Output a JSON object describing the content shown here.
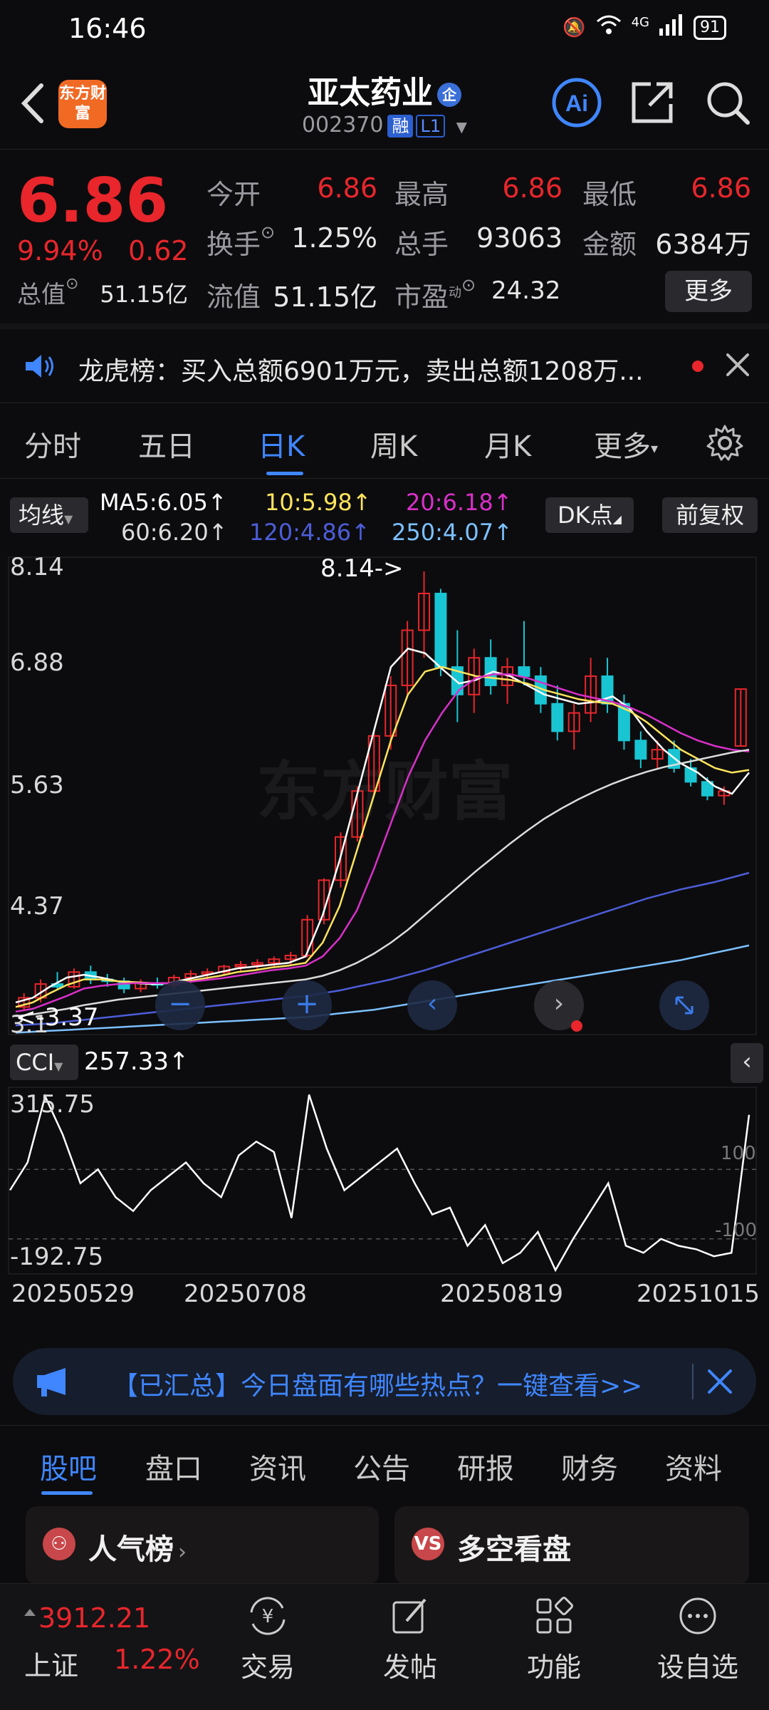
{
  "status_bar": {
    "time": "16:46",
    "network": "4G",
    "battery": "91"
  },
  "header": {
    "title": "亚太药业",
    "title_badge": "企",
    "code": "002370",
    "tag_margin": "融",
    "tag_level": "L1",
    "logo_text": "东方财富"
  },
  "quote": {
    "price": "6.86",
    "change_pct": "9.94%",
    "change": "0.62",
    "open_label": "今开",
    "open": "6.86",
    "high_label": "最高",
    "high": "6.86",
    "low_label": "最低",
    "low": "6.86",
    "turnover_label": "换手",
    "turnover": "1.25%",
    "volume_label": "总手",
    "volume": "93063",
    "amount_label": "金额",
    "amount": "6384万",
    "mktcap_label": "总值",
    "mktcap": "51.15亿",
    "float_label": "流值",
    "float": "51.15亿",
    "pe_label": "市盈",
    "pe_sup": "动",
    "pe": "24.32",
    "more_label": "更多"
  },
  "notice": {
    "text": "龙虎榜：买入总额6901万元，卖出总额1208万..."
  },
  "kline_tabs": [
    {
      "label": "分时"
    },
    {
      "label": "五日"
    },
    {
      "label": "日K"
    },
    {
      "label": "周K"
    },
    {
      "label": "月K"
    },
    {
      "label": "更多"
    }
  ],
  "active_kline_tab": "日K",
  "chart_controls": {
    "ma_button": "均线",
    "dk_button": "DK点",
    "fq_button": "前复权",
    "cci_button": "CCI"
  },
  "ma_legend": {
    "ma5": "MA5:6.05↑",
    "ma10": "10:5.98↑",
    "ma20": "20:6.18↑",
    "ma60": "60:6.20↑",
    "ma120": "120:4.86↑",
    "ma250": "250:4.07↑"
  },
  "colors": {
    "up": "#e8262c",
    "down": "#19c5d3",
    "ma5": "#ffffff",
    "ma10": "#ffe45c",
    "ma20": "#d830c8",
    "ma60": "#dcdcdc",
    "ma120": "#4d5dd8",
    "ma250": "#7cc0ff",
    "accent": "#3f86ff"
  },
  "chart_data": {
    "type": "line",
    "y_axis_labels": [
      "8.14",
      "6.88",
      "5.63",
      "4.37",
      "3.1"
    ],
    "ylim": [
      3.1,
      8.14
    ],
    "max_marker": "8.14->",
    "min_marker": "<-3.37",
    "x_ticks": [
      "20250529",
      "20250708",
      "20250819",
      "20251015"
    ],
    "series": [
      {
        "name": "MA5",
        "values": [
          3.45,
          3.5,
          3.62,
          3.72,
          3.75,
          3.72,
          3.68,
          3.66,
          3.65,
          3.66,
          3.7,
          3.74,
          3.78,
          3.82,
          3.84,
          3.86,
          3.88,
          3.95,
          4.4,
          5.0,
          5.7,
          6.4,
          7.1,
          7.3,
          7.25,
          7.08,
          6.92,
          6.96,
          7.05,
          7.0,
          6.9,
          6.8,
          6.75,
          6.7,
          6.72,
          6.78,
          6.65,
          6.4,
          6.2,
          6.05,
          5.95,
          5.8,
          5.72,
          5.95
        ]
      },
      {
        "name": "MA10",
        "values": [
          3.4,
          3.45,
          3.55,
          3.64,
          3.7,
          3.7,
          3.68,
          3.67,
          3.66,
          3.66,
          3.68,
          3.71,
          3.74,
          3.78,
          3.8,
          3.83,
          3.85,
          3.88,
          4.1,
          4.5,
          5.1,
          5.7,
          6.3,
          6.8,
          7.05,
          7.1,
          7.05,
          7.0,
          6.98,
          6.96,
          6.92,
          6.85,
          6.8,
          6.75,
          6.72,
          6.7,
          6.62,
          6.5,
          6.35,
          6.2,
          6.1,
          6.0,
          5.95,
          5.98
        ]
      },
      {
        "name": "MA20",
        "values": [
          3.35,
          3.38,
          3.45,
          3.52,
          3.6,
          3.63,
          3.65,
          3.66,
          3.66,
          3.66,
          3.67,
          3.69,
          3.71,
          3.74,
          3.77,
          3.8,
          3.82,
          3.85,
          3.95,
          4.15,
          4.45,
          4.9,
          5.4,
          5.9,
          6.3,
          6.6,
          6.85,
          6.98,
          7.02,
          7.02,
          6.98,
          6.92,
          6.86,
          6.8,
          6.76,
          6.72,
          6.66,
          6.58,
          6.48,
          6.38,
          6.3,
          6.24,
          6.2,
          6.18
        ]
      },
      {
        "name": "MA60",
        "values": [
          3.3,
          3.32,
          3.35,
          3.38,
          3.42,
          3.45,
          3.48,
          3.5,
          3.52,
          3.54,
          3.56,
          3.58,
          3.6,
          3.62,
          3.64,
          3.66,
          3.68,
          3.7,
          3.74,
          3.8,
          3.88,
          3.98,
          4.1,
          4.24,
          4.4,
          4.56,
          4.72,
          4.88,
          5.03,
          5.18,
          5.32,
          5.45,
          5.56,
          5.66,
          5.75,
          5.83,
          5.9,
          5.96,
          6.01,
          6.05,
          6.09,
          6.13,
          6.17,
          6.2
        ]
      },
      {
        "name": "MA120",
        "values": [
          3.2,
          3.21,
          3.22,
          3.24,
          3.26,
          3.28,
          3.3,
          3.32,
          3.34,
          3.36,
          3.38,
          3.4,
          3.42,
          3.44,
          3.46,
          3.48,
          3.5,
          3.52,
          3.55,
          3.58,
          3.62,
          3.66,
          3.7,
          3.75,
          3.8,
          3.86,
          3.92,
          3.98,
          4.04,
          4.1,
          4.16,
          4.22,
          4.28,
          4.34,
          4.4,
          4.46,
          4.52,
          4.58,
          4.63,
          4.68,
          4.72,
          4.76,
          4.81,
          4.86
        ]
      },
      {
        "name": "MA250",
        "values": [
          3.12,
          3.13,
          3.14,
          3.15,
          3.16,
          3.17,
          3.18,
          3.19,
          3.2,
          3.21,
          3.22,
          3.23,
          3.24,
          3.25,
          3.26,
          3.27,
          3.28,
          3.29,
          3.31,
          3.33,
          3.35,
          3.37,
          3.4,
          3.43,
          3.46,
          3.49,
          3.52,
          3.55,
          3.58,
          3.61,
          3.64,
          3.67,
          3.7,
          3.73,
          3.76,
          3.79,
          3.82,
          3.85,
          3.88,
          3.91,
          3.95,
          3.99,
          4.03,
          4.07
        ]
      }
    ],
    "candles": [
      [
        3.4,
        3.55,
        3.37,
        3.5
      ],
      [
        3.5,
        3.7,
        3.45,
        3.65
      ],
      [
        3.65,
        3.78,
        3.58,
        3.62
      ],
      [
        3.62,
        3.82,
        3.6,
        3.78
      ],
      [
        3.78,
        3.85,
        3.65,
        3.7
      ],
      [
        3.7,
        3.76,
        3.62,
        3.68
      ],
      [
        3.68,
        3.72,
        3.55,
        3.6
      ],
      [
        3.6,
        3.7,
        3.56,
        3.66
      ],
      [
        3.66,
        3.72,
        3.6,
        3.64
      ],
      [
        3.64,
        3.75,
        3.6,
        3.72
      ],
      [
        3.72,
        3.8,
        3.66,
        3.76
      ],
      [
        3.76,
        3.82,
        3.7,
        3.78
      ],
      [
        3.78,
        3.86,
        3.74,
        3.84
      ],
      [
        3.84,
        3.9,
        3.78,
        3.86
      ],
      [
        3.86,
        3.92,
        3.8,
        3.88
      ],
      [
        3.88,
        3.95,
        3.84,
        3.92
      ],
      [
        3.92,
        4.0,
        3.86,
        3.96
      ],
      [
        3.96,
        4.4,
        3.94,
        4.35
      ],
      [
        4.35,
        4.8,
        4.3,
        4.78
      ],
      [
        4.78,
        5.3,
        4.7,
        5.25
      ],
      [
        5.25,
        5.8,
        5.2,
        5.75
      ],
      [
        5.75,
        6.4,
        5.7,
        6.35
      ],
      [
        6.35,
        7.0,
        6.2,
        6.9
      ],
      [
        6.9,
        7.6,
        6.8,
        7.5
      ],
      [
        7.5,
        8.14,
        7.2,
        7.9
      ],
      [
        7.9,
        7.95,
        7.0,
        7.1
      ],
      [
        7.1,
        7.5,
        6.5,
        6.8
      ],
      [
        6.8,
        7.3,
        6.6,
        7.2
      ],
      [
        7.2,
        7.4,
        6.8,
        6.9
      ],
      [
        6.9,
        7.2,
        6.7,
        7.1
      ],
      [
        7.1,
        7.6,
        6.9,
        7.0
      ],
      [
        7.0,
        7.1,
        6.6,
        6.7
      ],
      [
        6.7,
        6.9,
        6.3,
        6.4
      ],
      [
        6.4,
        6.7,
        6.2,
        6.6
      ],
      [
        6.6,
        7.2,
        6.5,
        7.0
      ],
      [
        7.0,
        7.2,
        6.6,
        6.7
      ],
      [
        6.7,
        6.8,
        6.2,
        6.3
      ],
      [
        6.3,
        6.4,
        6.0,
        6.1
      ],
      [
        6.1,
        6.3,
        6.0,
        6.2
      ],
      [
        6.2,
        6.3,
        5.95,
        6.0
      ],
      [
        6.0,
        6.1,
        5.8,
        5.85
      ],
      [
        5.85,
        5.9,
        5.65,
        5.7
      ],
      [
        5.7,
        5.8,
        5.6,
        5.75
      ],
      [
        6.24,
        6.86,
        6.24,
        6.86
      ]
    ],
    "cci": {
      "label": "CCI",
      "value_label": "257.33↑",
      "top": "315.75",
      "bottom": "-192.75",
      "ref_high": "100",
      "ref_low": "-100",
      "values": [
        40,
        120,
        310,
        200,
        60,
        100,
        20,
        -20,
        40,
        80,
        120,
        60,
        20,
        140,
        180,
        150,
        -40,
        315,
        160,
        40,
        80,
        120,
        160,
        60,
        -30,
        -10,
        -120,
        -60,
        -170,
        -140,
        -80,
        -190,
        -100,
        -20,
        60,
        -120,
        -140,
        -100,
        -120,
        -130,
        -150,
        -140,
        257
      ]
    }
  },
  "banner": {
    "text": "【已汇总】今日盘面有哪些热点？一键查看>>"
  },
  "bottom_tabs": [
    {
      "label": "股吧"
    },
    {
      "label": "盘口"
    },
    {
      "label": "资讯"
    },
    {
      "label": "公告"
    },
    {
      "label": "研报"
    },
    {
      "label": "财务"
    },
    {
      "label": "资料"
    }
  ],
  "active_bottom_tab": "股吧",
  "cards": {
    "left": "人气榜",
    "right": "多空看盘",
    "right_icon": "VS"
  },
  "nav": {
    "index_name": "上证",
    "index_value": "3912.21",
    "index_change": "1.22%",
    "items": [
      {
        "label": "交易"
      },
      {
        "label": "发帖"
      },
      {
        "label": "功能"
      },
      {
        "label": "设自选"
      }
    ]
  }
}
